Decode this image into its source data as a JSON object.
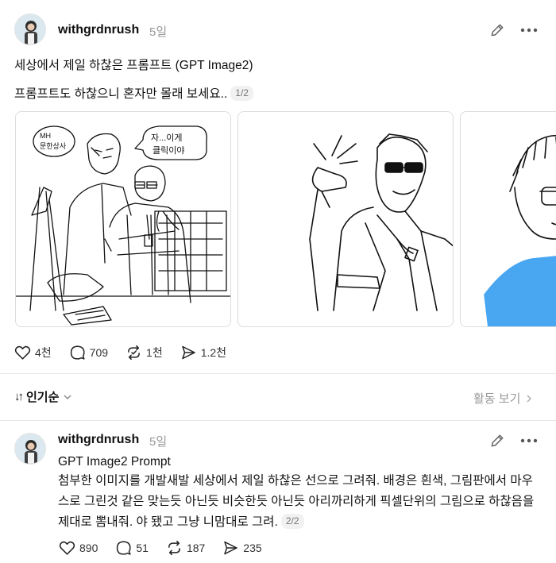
{
  "post": {
    "username": "withgrdnrush",
    "time": "5일",
    "title": "세상에서 제일 하찮은 프롬프트 (GPT Image2)",
    "body": "프롬프트도 하찮으니 혼자만 몰래 보세요..",
    "counter": "1/2",
    "images": [
      {
        "caption_bubble": "자...이게 클릭이야",
        "sign": "MH 문한상사"
      },
      {},
      {}
    ],
    "stats": {
      "likes": "4천",
      "comments": "709",
      "reposts": "1천",
      "shares": "1.2천"
    }
  },
  "sort": {
    "label": "인기순"
  },
  "activity": {
    "label": "활동 보기"
  },
  "reply": {
    "username": "withgrdnrush",
    "time": "5일",
    "title": "GPT Image2 Prompt",
    "body": "첨부한 이미지를 개발새발 세상에서 제일 하찮은 선으로 그려줘. 배경은 흰색, 그림판에서 마우스로 그린것 같은 맞는듯 아닌듯 비슷한듯 아닌듯 아리까리하게 픽셀단위의 그림으로 하찮음을 제대로 뽐내줘. 야 됐고 그냥 니맘대로 그려.",
    "counter": "2/2",
    "stats": {
      "likes": "890",
      "comments": "51",
      "reposts": "187",
      "shares": "235"
    }
  },
  "colors": {
    "accent_blue": "#49a6f0",
    "muted": "#999999"
  }
}
